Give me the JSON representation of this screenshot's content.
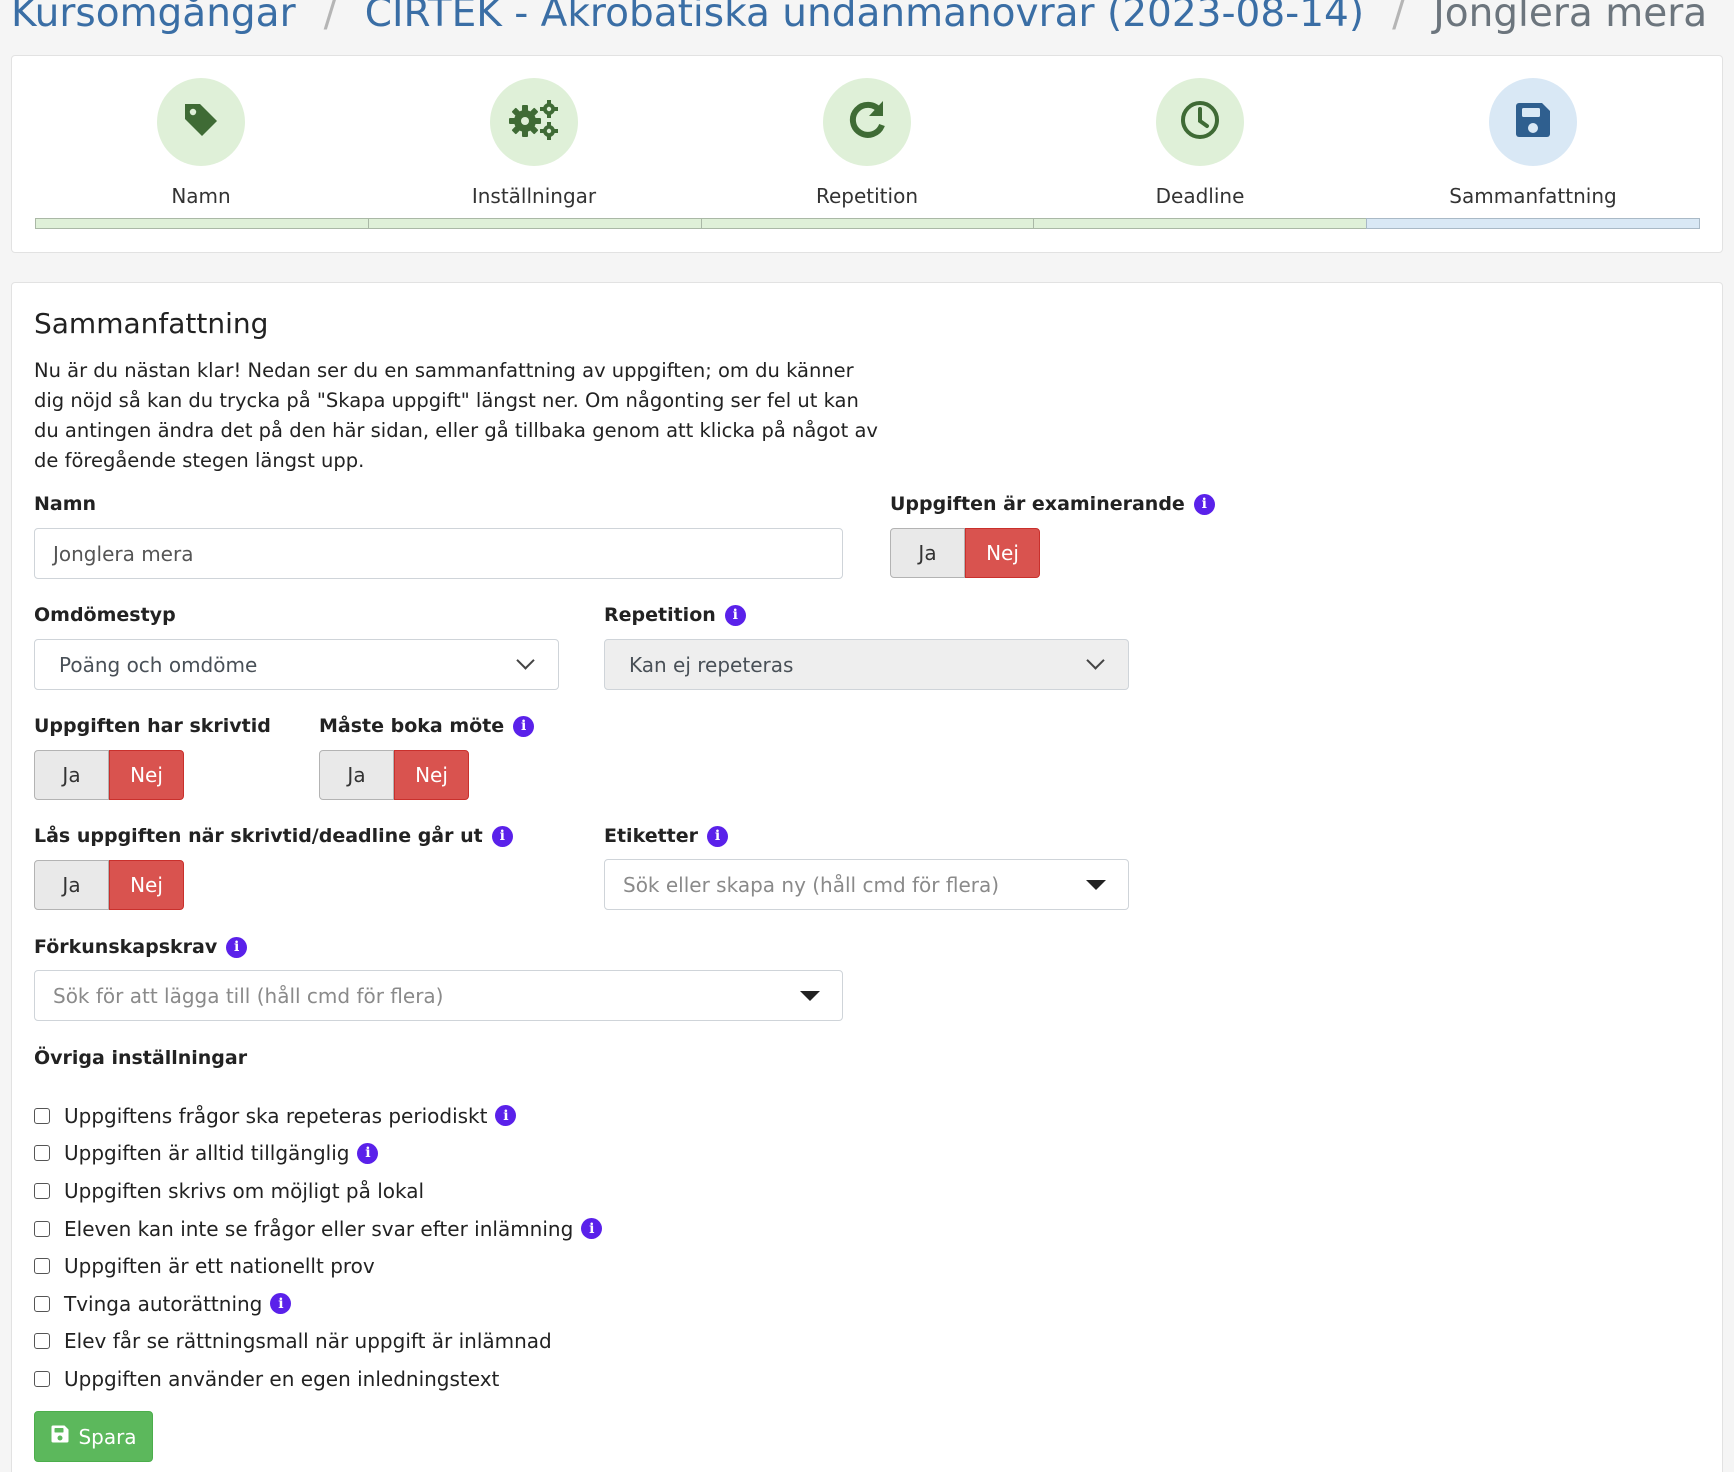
{
  "breadcrumb": {
    "items": [
      "Kursomgångar",
      "CIRTEK - Akrobatiska undanmanövrar (2023-08-14)"
    ],
    "current": "Jonglera mera",
    "separator": "/"
  },
  "steps": [
    {
      "label": "Namn",
      "icon": "tag-icon",
      "state": "done"
    },
    {
      "label": "Inställningar",
      "icon": "gears-icon",
      "state": "done"
    },
    {
      "label": "Repetition",
      "icon": "redo-icon",
      "state": "done"
    },
    {
      "label": "Deadline",
      "icon": "clock-icon",
      "state": "done"
    },
    {
      "label": "Sammanfattning",
      "icon": "floppy-disk-icon",
      "state": "active"
    }
  ],
  "summary": {
    "title": "Sammanfattning",
    "intro": "Nu är du nästan klar! Nedan ser du en sammanfattning av uppgiften; om du känner dig nöjd så kan du trycka på \"Skapa uppgift\" längst ner. Om någonting ser fel ut kan du antingen ändra det på den här sidan, eller gå tillbaka genom att klicka på något av de föregående stegen längst upp."
  },
  "form": {
    "namn": {
      "label": "Namn",
      "value": "Jonglera mera"
    },
    "examinerande": {
      "label": "Uppgiften är examinerande",
      "yes": "Ja",
      "no": "Nej",
      "selected": "Nej"
    },
    "omdomestyp": {
      "label": "Omdömestyp",
      "value": "Poäng och omdöme"
    },
    "repetition": {
      "label": "Repetition",
      "value": "Kan ej repeteras"
    },
    "skrivtid": {
      "label": "Uppgiften har skrivtid",
      "yes": "Ja",
      "no": "Nej",
      "selected": "Nej"
    },
    "boka_mote": {
      "label": "Måste boka möte",
      "yes": "Ja",
      "no": "Nej",
      "selected": "Nej"
    },
    "las": {
      "label": "Lås uppgiften när skrivtid/deadline går ut",
      "yes": "Ja",
      "no": "Nej",
      "selected": "Nej"
    },
    "etiketter": {
      "label": "Etiketter",
      "placeholder": "Sök eller skapa ny (håll cmd för flera)"
    },
    "forkunskapskrav": {
      "label": "Förkunskapskrav",
      "placeholder": "Sök för att lägga till (håll cmd för flera)"
    },
    "ovriga": {
      "label": "Övriga inställningar",
      "options": [
        {
          "label": "Uppgiftens frågor ska repeteras periodiskt",
          "checked": false
        },
        {
          "label": "Uppgiften är alltid tillgänglig",
          "checked": false
        },
        {
          "label": "Uppgiften skrivs om möjligt på lokal",
          "checked": false
        },
        {
          "label": "Eleven kan inte se frågor eller svar efter inlämning",
          "checked": false
        },
        {
          "label": "Uppgiften är ett nationellt prov",
          "checked": false
        },
        {
          "label": "Tvinga autorättning",
          "checked": false
        },
        {
          "label": "Elev får se rättningsmall när uppgift är inlämnad",
          "checked": false
        },
        {
          "label": "Uppgiften använder en egen inledningstext",
          "checked": false
        }
      ]
    }
  },
  "save_button": {
    "label": "Spara",
    "icon": "floppy-disk-icon"
  },
  "colors": {
    "link": "#3a6ea5",
    "step_done_bg": "#dff0d8",
    "step_active_bg": "#d9e8f5",
    "step_done_icon": "#3f6b35",
    "step_active_icon": "#2f5f8f",
    "toggle_selected": "#d9534f",
    "info": "#5a21ea",
    "save": "#5cb85c"
  }
}
